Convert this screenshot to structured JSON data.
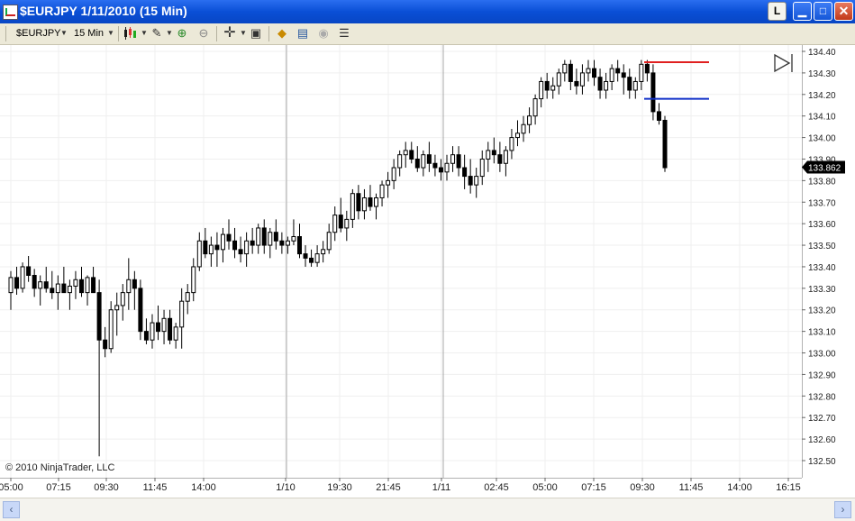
{
  "window": {
    "title": "$EURJPY  1/11/2010 (15 Min)",
    "btn_link": "L",
    "btn_min": "▁",
    "btn_max": "□",
    "btn_close": "✕"
  },
  "toolbar": {
    "instrument": "$EURJPY",
    "interval": "15 Min"
  },
  "chart": {
    "copyright": "© 2010 NinjaTrader, LLC",
    "last_price": "133.862",
    "last_price_color": "#000000",
    "stop_line_color": "#e02020",
    "target_line_color": "#1030c8",
    "y_ticks": [
      "134.40",
      "134.30",
      "134.20",
      "134.10",
      "134.00",
      "133.90",
      "133.80",
      "133.70",
      "133.60",
      "133.50",
      "133.40",
      "133.30",
      "133.20",
      "133.10",
      "133.00",
      "132.90",
      "132.80",
      "132.70",
      "132.60",
      "132.50"
    ],
    "x_ticks": [
      "05:00",
      "07:15",
      "09:30",
      "11:45",
      "14:00",
      "1/10",
      "19:30",
      "21:45",
      "1/11",
      "02:45",
      "05:00",
      "07:15",
      "09:30",
      "11:45",
      "14:00",
      "16:15"
    ]
  },
  "chart_data": {
    "type": "candlestick",
    "title": "$EURJPY  1/11/2010 (15 Min)",
    "ylim": [
      132.47,
      134.43
    ],
    "last_price": 133.862,
    "ohlc": [
      [
        133.28,
        133.38,
        133.2,
        133.35
      ],
      [
        133.35,
        133.4,
        133.27,
        133.3
      ],
      [
        133.3,
        133.42,
        133.28,
        133.4
      ],
      [
        133.4,
        133.45,
        133.33,
        133.36
      ],
      [
        133.36,
        133.39,
        133.26,
        133.3
      ],
      [
        133.3,
        133.36,
        133.22,
        133.33
      ],
      [
        133.33,
        133.4,
        133.28,
        133.3
      ],
      [
        133.3,
        133.38,
        133.25,
        133.28
      ],
      [
        133.28,
        133.36,
        133.2,
        133.32
      ],
      [
        133.32,
        133.4,
        133.28,
        133.28
      ],
      [
        133.28,
        133.34,
        133.2,
        133.31
      ],
      [
        133.31,
        133.38,
        133.25,
        133.34
      ],
      [
        133.34,
        133.4,
        133.26,
        133.28
      ],
      [
        133.28,
        133.36,
        133.22,
        133.35
      ],
      [
        133.35,
        133.4,
        133.28,
        133.28
      ],
      [
        133.28,
        133.34,
        132.52,
        133.06
      ],
      [
        133.06,
        133.12,
        132.98,
        133.02
      ],
      [
        133.02,
        133.24,
        133.0,
        133.2
      ],
      [
        133.2,
        133.28,
        133.08,
        133.22
      ],
      [
        133.22,
        133.32,
        133.15,
        133.28
      ],
      [
        133.28,
        133.44,
        133.2,
        133.34
      ],
      [
        133.34,
        133.38,
        133.2,
        133.3
      ],
      [
        133.3,
        133.34,
        133.06,
        133.1
      ],
      [
        133.1,
        133.16,
        133.04,
        133.06
      ],
      [
        133.06,
        133.18,
        133.02,
        133.14
      ],
      [
        133.14,
        133.22,
        133.06,
        133.1
      ],
      [
        133.1,
        133.2,
        133.04,
        133.16
      ],
      [
        133.16,
        133.2,
        133.04,
        133.06
      ],
      [
        133.06,
        133.14,
        133.02,
        133.12
      ],
      [
        133.12,
        133.3,
        133.02,
        133.24
      ],
      [
        133.24,
        133.32,
        133.18,
        133.28
      ],
      [
        133.28,
        133.44,
        133.24,
        133.4
      ],
      [
        133.4,
        133.56,
        133.38,
        133.52
      ],
      [
        133.52,
        133.58,
        133.44,
        133.46
      ],
      [
        133.46,
        133.54,
        133.4,
        133.5
      ],
      [
        133.5,
        133.56,
        133.4,
        133.48
      ],
      [
        133.48,
        133.58,
        133.42,
        133.55
      ],
      [
        133.55,
        133.62,
        133.48,
        133.52
      ],
      [
        133.52,
        133.58,
        133.44,
        133.48
      ],
      [
        133.48,
        133.54,
        133.42,
        133.46
      ],
      [
        133.46,
        133.56,
        133.4,
        133.52
      ],
      [
        133.52,
        133.58,
        133.46,
        133.5
      ],
      [
        133.5,
        133.6,
        133.46,
        133.58
      ],
      [
        133.58,
        133.62,
        133.46,
        133.5
      ],
      [
        133.5,
        133.58,
        133.44,
        133.56
      ],
      [
        133.56,
        133.62,
        133.48,
        133.52
      ],
      [
        133.52,
        133.56,
        133.46,
        133.5
      ],
      [
        133.5,
        133.54,
        133.46,
        133.52
      ],
      [
        133.52,
        133.62,
        133.5,
        133.54
      ],
      [
        133.54,
        133.6,
        133.44,
        133.46
      ],
      [
        133.46,
        133.5,
        133.4,
        133.44
      ],
      [
        133.44,
        133.48,
        133.4,
        133.42
      ],
      [
        133.42,
        133.5,
        133.4,
        133.46
      ],
      [
        133.46,
        133.52,
        133.42,
        133.48
      ],
      [
        133.48,
        133.6,
        133.46,
        133.56
      ],
      [
        133.56,
        133.68,
        133.52,
        133.64
      ],
      [
        133.64,
        133.72,
        133.56,
        133.58
      ],
      [
        133.58,
        133.66,
        133.52,
        133.62
      ],
      [
        133.62,
        133.76,
        133.58,
        133.74
      ],
      [
        133.74,
        133.78,
        133.62,
        133.66
      ],
      [
        133.66,
        133.76,
        133.62,
        133.72
      ],
      [
        133.72,
        133.78,
        133.66,
        133.68
      ],
      [
        133.68,
        133.74,
        133.62,
        133.72
      ],
      [
        133.72,
        133.8,
        133.68,
        133.78
      ],
      [
        133.78,
        133.84,
        133.72,
        133.8
      ],
      [
        133.8,
        133.9,
        133.76,
        133.86
      ],
      [
        133.86,
        133.94,
        133.82,
        133.92
      ],
      [
        133.92,
        133.98,
        133.86,
        133.94
      ],
      [
        133.94,
        133.98,
        133.88,
        133.9
      ],
      [
        133.9,
        133.96,
        133.84,
        133.86
      ],
      [
        133.86,
        133.94,
        133.82,
        133.92
      ],
      [
        133.92,
        133.98,
        133.84,
        133.88
      ],
      [
        133.88,
        133.92,
        133.82,
        133.86
      ],
      [
        133.86,
        133.9,
        133.8,
        133.84
      ],
      [
        133.84,
        133.92,
        133.8,
        133.88
      ],
      [
        133.88,
        133.96,
        133.84,
        133.92
      ],
      [
        133.92,
        133.96,
        133.82,
        133.86
      ],
      [
        133.86,
        133.92,
        133.76,
        133.82
      ],
      [
        133.82,
        133.9,
        133.74,
        133.78
      ],
      [
        133.78,
        133.86,
        133.72,
        133.82
      ],
      [
        133.82,
        133.94,
        133.78,
        133.9
      ],
      [
        133.9,
        133.98,
        133.84,
        133.94
      ],
      [
        133.94,
        134.0,
        133.88,
        133.92
      ],
      [
        133.92,
        133.98,
        133.84,
        133.88
      ],
      [
        133.88,
        133.96,
        133.82,
        133.94
      ],
      [
        133.94,
        134.04,
        133.9,
        134.0
      ],
      [
        134.0,
        134.08,
        133.96,
        134.02
      ],
      [
        134.02,
        134.1,
        133.98,
        134.06
      ],
      [
        134.06,
        134.14,
        134.02,
        134.1
      ],
      [
        134.1,
        134.2,
        134.06,
        134.18
      ],
      [
        134.18,
        134.28,
        134.14,
        134.26
      ],
      [
        134.26,
        134.3,
        134.18,
        134.22
      ],
      [
        134.22,
        134.28,
        134.18,
        134.24
      ],
      [
        134.24,
        134.32,
        134.2,
        134.3
      ],
      [
        134.3,
        134.36,
        134.26,
        134.34
      ],
      [
        134.34,
        134.36,
        134.22,
        134.26
      ],
      [
        134.26,
        134.32,
        134.2,
        134.24
      ],
      [
        134.24,
        134.34,
        134.2,
        134.3
      ],
      [
        134.3,
        134.36,
        134.26,
        134.32
      ],
      [
        134.32,
        134.36,
        134.24,
        134.28
      ],
      [
        134.28,
        134.32,
        134.18,
        134.22
      ],
      [
        134.22,
        134.3,
        134.18,
        134.26
      ],
      [
        134.26,
        134.34,
        134.22,
        134.32
      ],
      [
        134.32,
        134.36,
        134.26,
        134.3
      ],
      [
        134.3,
        134.34,
        134.2,
        134.28
      ],
      [
        134.28,
        134.32,
        134.18,
        134.22
      ],
      [
        134.22,
        134.28,
        134.18,
        134.26
      ],
      [
        134.26,
        134.36,
        134.22,
        134.34
      ],
      [
        134.34,
        134.36,
        134.26,
        134.3
      ],
      [
        134.3,
        134.34,
        134.08,
        134.12
      ],
      [
        134.12,
        134.16,
        134.06,
        134.08
      ],
      [
        134.08,
        134.1,
        133.84,
        133.86
      ]
    ]
  }
}
